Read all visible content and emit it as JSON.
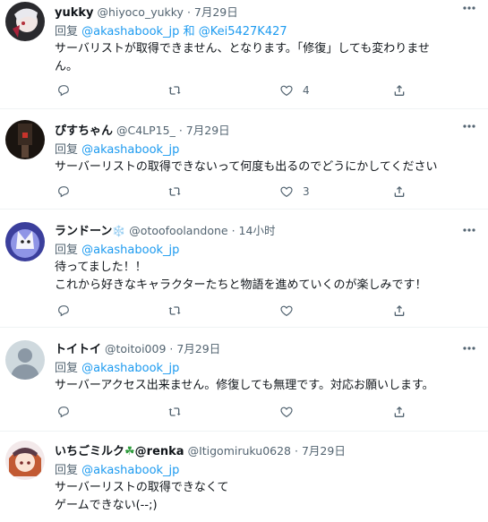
{
  "reply_prefix": "回复",
  "tweets": [
    {
      "name": "yukky",
      "handle": "@hiyoco_yukky",
      "time": "7月29日",
      "mentions": [
        "@akashabook_jp",
        "和",
        "@Kei5427K427"
      ],
      "text": "サーバリストが取得できません、となります。「修復」しても変わりませ\nん。",
      "likes": "4"
    },
    {
      "name": "ぴすちゃん",
      "handle": "@C4LP15_",
      "time": "7月29日",
      "mentions": [
        "@akashabook_jp"
      ],
      "text": "サーバーリストの取得できないって何度も出るのでどうにかしてください",
      "likes": "3"
    },
    {
      "name": "ランドーン",
      "name_suffix": "❄️",
      "handle": "@otoofoolandone",
      "time": "14小时",
      "mentions": [
        "@akashabook_jp"
      ],
      "text": "待ってました！！\nこれから好きなキャラクターたちと物語を進めていくのが楽しみです！",
      "likes": ""
    },
    {
      "name": "トイトイ",
      "handle": "@toitoi009",
      "time": "7月29日",
      "mentions": [
        "@akashabook_jp"
      ],
      "text": "サーバーアクセス出来ません。修復しても無理です。対応お願いします。",
      "likes": ""
    },
    {
      "name": "いちごミルク",
      "name_suffix": "☘",
      "name_tail": "@renka",
      "handle": "@Itigomiruku0628",
      "time": "7月29日",
      "mentions": [
        "@akashabook_jp"
      ],
      "text": "サーバーリストの取得できなくて\nゲームできない(--;)",
      "likes": ""
    }
  ],
  "icons": {
    "reply": "reply-icon",
    "retweet": "retweet-icon",
    "like": "heart-icon",
    "share": "share-icon",
    "more": "more-icon"
  },
  "colors": {
    "link": "#1d9bf0",
    "secondary": "#536471",
    "text": "#0f1419"
  }
}
